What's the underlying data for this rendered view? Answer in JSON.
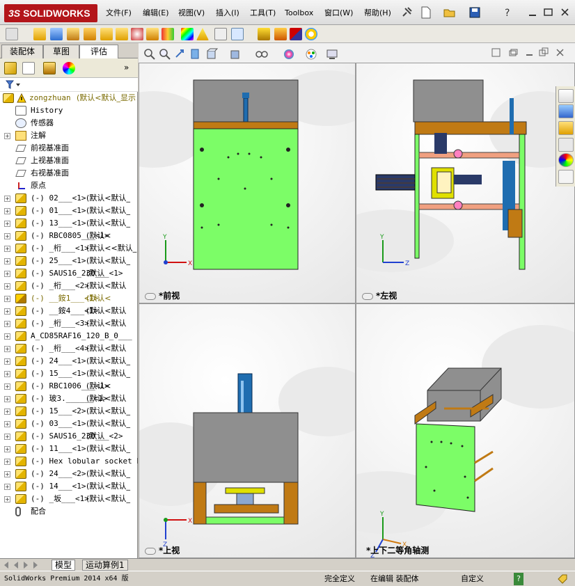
{
  "app": {
    "logo_text": "SOLIDWORKS",
    "logo_prefix": "3S"
  },
  "menu": [
    "文件(F)",
    "编辑(E)",
    "视图(V)",
    "插入(I)",
    "工具(T)",
    "Toolbox",
    "窗口(W)",
    "帮助(H)"
  ],
  "feature_manager": {
    "tabs": [
      "装配体",
      "草图",
      "评估"
    ],
    "active_tab": "评估",
    "root": {
      "name": "zongzhuan",
      "config": "(默认<默认_显示"
    },
    "tree": [
      {
        "expand": "",
        "icon": "history",
        "name": "History",
        "config": ""
      },
      {
        "expand": "",
        "icon": "sensor",
        "name": "传感器",
        "config": ""
      },
      {
        "expand": "+",
        "icon": "annotation",
        "name": "注解",
        "config": ""
      },
      {
        "expand": "",
        "icon": "plane",
        "name": "前视基准面",
        "config": ""
      },
      {
        "expand": "",
        "icon": "plane",
        "name": "上视基准面",
        "config": ""
      },
      {
        "expand": "",
        "icon": "plane",
        "name": "右视基准面",
        "config": ""
      },
      {
        "expand": "",
        "icon": "origin",
        "name": "原点",
        "config": ""
      },
      {
        "expand": "+",
        "icon": "asm",
        "name": "(-) 02___<1>",
        "config": "(默认<默认_"
      },
      {
        "expand": "+",
        "icon": "asm",
        "name": "(-) 01___<1>",
        "config": "(默认<默认_"
      },
      {
        "expand": "+",
        "icon": "asm",
        "name": "(-) 13___<1>",
        "config": "(默认<默认_"
      },
      {
        "expand": "+",
        "icon": "asm",
        "name": "(-) RBC0805___<1>",
        "config": "(默认<"
      },
      {
        "expand": "+",
        "icon": "asm",
        "name": "(-) _桁___<1>",
        "config": "(默认<<默认_"
      },
      {
        "expand": "+",
        "icon": "asm",
        "name": "(-) 25___<1>",
        "config": "(默认<默认_"
      },
      {
        "expand": "+",
        "icon": "asm",
        "name": "(-) SAUS16_230___<1>",
        "config": "(默认"
      },
      {
        "expand": "+",
        "icon": "asm",
        "name": "(-) _桁___<2>",
        "config": "(默认<默认"
      },
      {
        "expand": "+",
        "icon": "warn",
        "name": "(-) __銨1___<1>",
        "config": "(默认<"
      },
      {
        "expand": "+",
        "icon": "asm",
        "name": "(-) __銨4___<1>",
        "config": "(默认<默认"
      },
      {
        "expand": "+",
        "icon": "asm",
        "name": "(-) _桁___<3>",
        "config": "(默认<默认"
      },
      {
        "expand": "+",
        "icon": "asm",
        "name": "A_CD85RAF16_120_B_0___",
        "config": ""
      },
      {
        "expand": "+",
        "icon": "asm",
        "name": "(-) _桁___<4>",
        "config": "(默认<默认"
      },
      {
        "expand": "+",
        "icon": "asm",
        "name": "(-) 24___<1>",
        "config": "(默认<默认_"
      },
      {
        "expand": "+",
        "icon": "asm",
        "name": "(-) 15___<1>",
        "config": "(默认<默认_"
      },
      {
        "expand": "+",
        "icon": "asm",
        "name": "(-) RBC1006___<1>",
        "config": "(默认<"
      },
      {
        "expand": "+",
        "icon": "asm",
        "name": "(-) 玻3.______<1>",
        "config": "(默认<默认"
      },
      {
        "expand": "+",
        "icon": "asm",
        "name": "(-) 15___<2>",
        "config": "(默认<默认_"
      },
      {
        "expand": "+",
        "icon": "asm",
        "name": "(-) 03___<1>",
        "config": "(默认<默认_"
      },
      {
        "expand": "+",
        "icon": "asm",
        "name": "(-) SAUS16_230___<2>",
        "config": "(默认"
      },
      {
        "expand": "+",
        "icon": "asm",
        "name": "(-) 11___<1>",
        "config": "(默认<默认_"
      },
      {
        "expand": "+",
        "icon": "asm",
        "name": "(-) Hex lobular socket hea",
        "config": ""
      },
      {
        "expand": "+",
        "icon": "asm",
        "name": "(-) 24___<2>",
        "config": "(默认<默认_"
      },
      {
        "expand": "+",
        "icon": "asm",
        "name": "(-) 14___<1>",
        "config": "(默认<默认_"
      },
      {
        "expand": "+",
        "icon": "asm",
        "name": "(-) _坂___<1>",
        "config": "(默认<默认_"
      },
      {
        "expand": "",
        "icon": "mate",
        "name": "配合",
        "config": ""
      }
    ]
  },
  "viewports": [
    {
      "label": "*前视",
      "view": "front"
    },
    {
      "label": "*左视",
      "view": "left"
    },
    {
      "label": "*上视",
      "view": "top"
    },
    {
      "label": "*上下二等角轴测",
      "view": "iso"
    }
  ],
  "bottom_tabs": [
    "模型",
    "运动算例1"
  ],
  "status": {
    "product": "SolidWorks Premium 2014 x64 版",
    "definition": "完全定义",
    "editing": "在编辑 装配体",
    "custom": "自定义",
    "help": "?"
  },
  "colors": {
    "plate_green": "#7cfd67",
    "block_gray": "#8f8f8f",
    "wood_brown": "#c07a14",
    "frame_blue": "#1f6db0",
    "brand_red": "#b3151a"
  }
}
